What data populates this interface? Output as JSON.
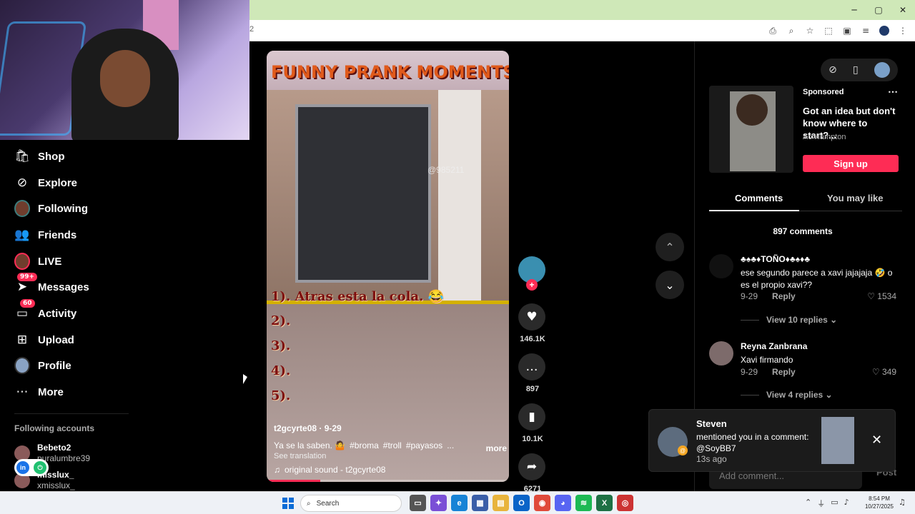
{
  "browser": {
    "url_fragment": "2",
    "window_controls": [
      "─",
      "▢",
      "✕"
    ],
    "toolbar_icons": [
      "install-icon",
      "zoom-icon",
      "star-icon",
      "extensions-icon",
      "sidepanel-icon",
      "media-icon",
      "profile-icon",
      "menu-icon"
    ]
  },
  "sidebar": {
    "items": [
      {
        "label": "Shop",
        "icon": "shop-icon"
      },
      {
        "label": "Explore",
        "icon": "compass-icon"
      },
      {
        "label": "Following",
        "icon": "following-avatar"
      },
      {
        "label": "Friends",
        "icon": "friends-icon"
      },
      {
        "label": "LIVE",
        "icon": "live-avatar"
      },
      {
        "label": "Messages",
        "icon": "messages-icon",
        "badge": "99+"
      },
      {
        "label": "Activity",
        "icon": "activity-icon",
        "badge": "60"
      },
      {
        "label": "Upload",
        "icon": "upload-icon"
      },
      {
        "label": "Profile",
        "icon": "profile-avatar"
      },
      {
        "label": "More",
        "icon": "more-icon"
      }
    ],
    "following_title": "Following accounts",
    "accounts": [
      {
        "username": "Bebeto2",
        "name": "puralumbre39"
      },
      {
        "username": "misslux_",
        "name": "xmisslux_"
      }
    ]
  },
  "video": {
    "title_overlay": "FUNNY PRANK MOMENTS",
    "watermark": "@985211",
    "list": [
      "1). Atras esta la cola. 😂",
      "2).",
      "3).",
      "4).",
      "5)."
    ],
    "author": "t2gcyrte08 · 9-29",
    "caption": "Ya se la saben. 🤷",
    "hashtags": [
      "#broma",
      "#troll",
      "#payasos",
      "..."
    ],
    "more": "more",
    "see_translation": "See translation",
    "sound": "original sound - t2gcyrte08",
    "progress": 0.22
  },
  "actions": {
    "likes": "146.1K",
    "comments": "897",
    "saves": "10.1K",
    "shares": "6271"
  },
  "right_panel": {
    "ad": {
      "sponsored": "Sponsored",
      "headline": "Got an idea but don't know where to start?...",
      "advertiser": "Ac Hampton",
      "cta": "Sign up"
    },
    "tabs": [
      "Comments",
      "You may like"
    ],
    "comment_count": "897 comments",
    "comments": [
      {
        "user": "♣♠♣♦TOÑO♦♣♠♦♣",
        "text": "ese segundo parece a xavi jajajaja 🤣 o es el propio xavi??",
        "date": "9-29",
        "reply": "Reply",
        "likes": "1534",
        "view_replies": "View 10 replies ⌄"
      },
      {
        "user": "Reyna Zanbrana",
        "text": "Xavi firmando",
        "date": "9-29",
        "reply": "Reply",
        "likes": "349",
        "view_replies": "View 4 replies ⌄"
      }
    ],
    "add_comment_placeholder": "Add comment...",
    "post": "Post"
  },
  "notification": {
    "name": "Steven",
    "message": "mentioned you in a comment: @SoyBB7",
    "time": "13s ago"
  },
  "taskbar": {
    "search": "Search",
    "time": "8:54 PM",
    "date": "10/27/2025"
  }
}
